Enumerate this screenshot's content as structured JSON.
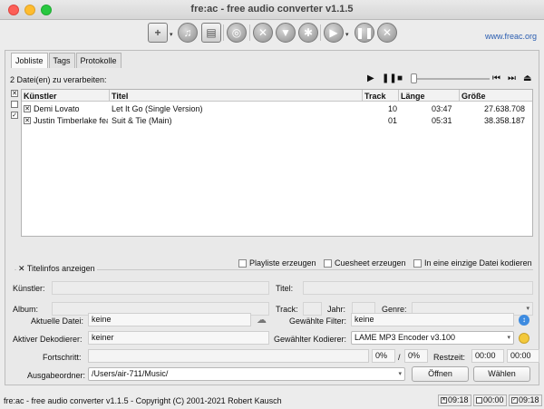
{
  "window": {
    "title": "fre:ac - free audio converter v1.1.5"
  },
  "toolbar": {
    "site_link": "www.freac.org",
    "icons": [
      "add-files-icon",
      "cd-add-icon",
      "file-add-icon",
      "cddb-query-icon",
      "settings-icon",
      "filter-icon",
      "gear-icon",
      "play-icon",
      "pause-icon",
      "stop-icon"
    ]
  },
  "tabs": [
    {
      "label": "Jobliste"
    },
    {
      "label": "Tags"
    },
    {
      "label": "Protokolle"
    }
  ],
  "joblist": {
    "count_text": "2 Datei(en) zu verarbeiten:",
    "columns": [
      "Künstler",
      "Titel",
      "Track",
      "Länge",
      "Größe"
    ],
    "rows": [
      {
        "artist": "Demi Lovato",
        "title": "Let It Go (Single Version)",
        "track": "10",
        "length": "03:47",
        "size": "27.638.708",
        "checked": true
      },
      {
        "artist": "Justin Timberlake feat.",
        "title": "Suit & Tie (Main)",
        "track": "01",
        "length": "05:31",
        "size": "38.358.187",
        "checked": true
      }
    ]
  },
  "options": {
    "playlist": "Playliste erzeugen",
    "cuesheet": "Cuesheet erzeugen",
    "single_file": "In eine einzige Datei kodieren"
  },
  "titleinfo": {
    "toggle_label": "Titelinfos anzeigen",
    "artist_label": "Künstler:",
    "title_label": "Titel:",
    "album_label": "Album:",
    "track_label": "Track:",
    "year_label": "Jahr:",
    "genre_label": "Genre:"
  },
  "progress": {
    "current_file_label": "Aktuelle Datei:",
    "current_file_value": "keine",
    "filter_label": "Gewählte Filter:",
    "filter_value": "keine",
    "decoder_label": "Aktiver Dekodierer:",
    "decoder_value": "keiner",
    "encoder_label": "Gewählter Kodierer:",
    "encoder_value": "LAME MP3 Encoder v3.100",
    "progress_label": "Fortschritt:",
    "progress_file_pct": "0%",
    "slash": "/",
    "progress_total_pct": "0%",
    "remaining_label": "Restzeit:",
    "remaining_file": "00:00",
    "remaining_total": "00:00",
    "output_label": "Ausgabeordner:",
    "output_value": "/Users/air-711/Music/",
    "open_button": "Öffnen",
    "choose_button": "Wählen"
  },
  "status": {
    "text": "fre:ac - free audio converter v1.1.5 - Copyright (C) 2001-2021 Robert Kausch",
    "time1": "09:18",
    "time2": "00:00",
    "time3": "09:18"
  }
}
